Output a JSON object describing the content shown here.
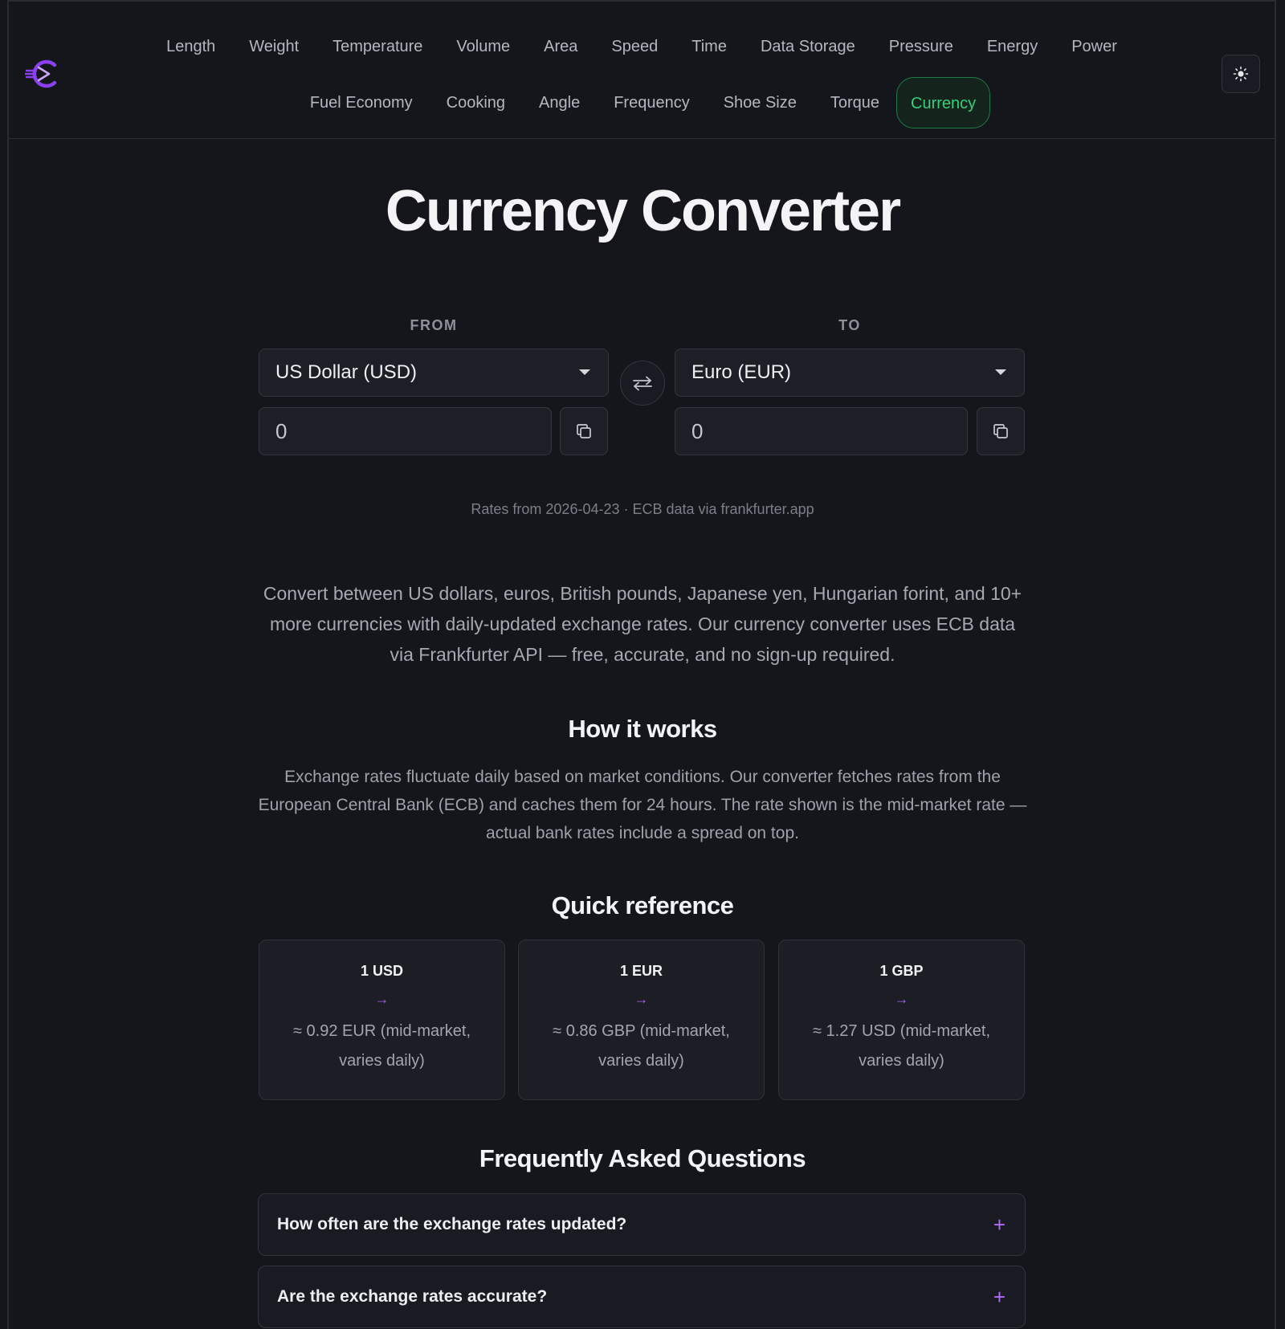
{
  "nav": {
    "row1": [
      "Length",
      "Weight",
      "Temperature",
      "Volume",
      "Area",
      "Speed",
      "Time",
      "Data Storage",
      "Pressure",
      "Energy",
      "Power"
    ],
    "row2": [
      "Fuel Economy",
      "Cooking",
      "Angle",
      "Frequency",
      "Shoe Size",
      "Torque",
      "Currency"
    ],
    "active": "Currency"
  },
  "logo": {
    "icon": "logo-c-icon",
    "color": "#8b3ff0"
  },
  "theme_toggle": {
    "icon": "sun-icon"
  },
  "page_title": "Currency Converter",
  "converter": {
    "from_label": "FROM",
    "to_label": "TO",
    "from_currency": "US Dollar (USD)",
    "to_currency": "Euro (EUR)",
    "from_amount": "0",
    "to_amount": "0",
    "swap_icon": "swap-arrows-icon",
    "copy_icon": "copy-icon"
  },
  "rates_note": "Rates from 2026-04-23 · ECB data via frankfurter.app",
  "intro": "Convert between US dollars, euros, British pounds, Japanese yen, Hungarian forint, and 10+ more currencies with daily-updated exchange rates. Our currency converter uses ECB data via Frankfurter API — free, accurate, and no sign-up required.",
  "how_it_works": {
    "title": "How it works",
    "text": "Exchange rates fluctuate daily based on market conditions. Our converter fetches rates from the European Central Bank (ECB) and caches them for 24 hours. The rate shown is the mid-market rate — actual bank rates include a spread on top."
  },
  "quick_reference": {
    "title": "Quick reference",
    "cards": [
      {
        "head": "1 USD",
        "arrow": "→",
        "value": "≈ 0.92 EUR (mid-market, varies daily)"
      },
      {
        "head": "1 EUR",
        "arrow": "→",
        "value": "≈ 0.86 GBP (mid-market, varies daily)"
      },
      {
        "head": "1 GBP",
        "arrow": "→",
        "value": "≈ 1.27 USD (mid-market, varies daily)"
      }
    ]
  },
  "faq": {
    "title": "Frequently Asked Questions",
    "items": [
      {
        "question": "How often are the exchange rates updated?",
        "toggle": "+"
      },
      {
        "question": "Are the exchange rates accurate?",
        "toggle": "+"
      }
    ]
  },
  "colors": {
    "background": "#15161c",
    "accent_green": "#35d07a",
    "accent_purple": "#a463f2"
  }
}
